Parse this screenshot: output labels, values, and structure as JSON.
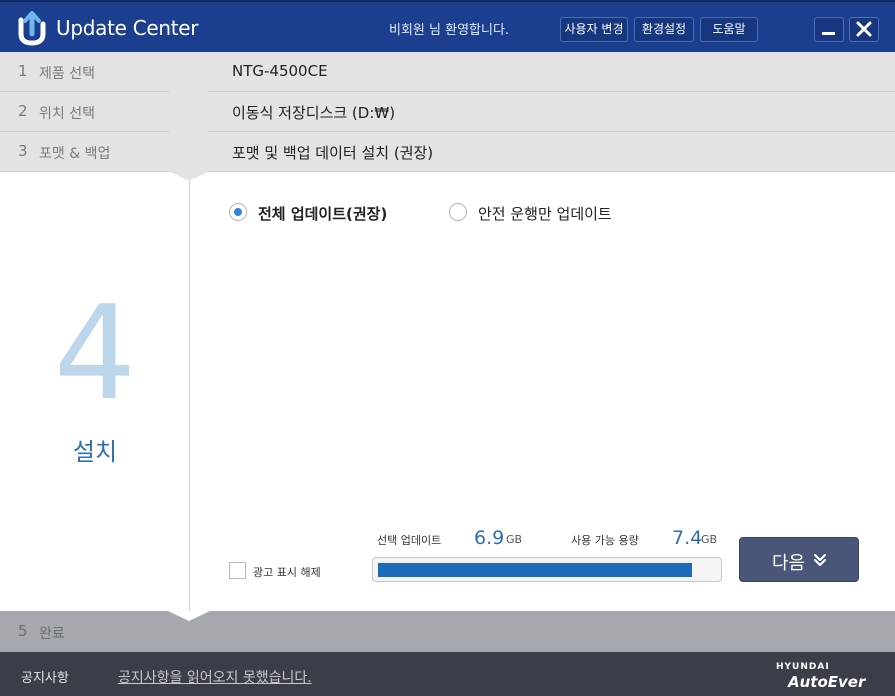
{
  "app": {
    "title": "Update Center",
    "welcome": "비회원 님 환영합니다.",
    "buttons": {
      "change_user": "사용자 변경",
      "settings": "환경설정",
      "help": "도움말"
    }
  },
  "steps": [
    {
      "num": "1",
      "name": "제품 선택",
      "value": "NTG-4500CE"
    },
    {
      "num": "2",
      "name": "위치 선택",
      "value": "이동식 저장디스크 (D:₩)"
    },
    {
      "num": "3",
      "name": "포맷 & 백업",
      "value": "포맷 및 백업 데이터 설치 (권장)"
    }
  ],
  "current_step": {
    "num": "4",
    "name": "설치"
  },
  "options": {
    "full_update": {
      "label": "전체 업데이트(권장)",
      "selected": true
    },
    "safe_only": {
      "label": "안전 운행만 업데이트",
      "selected": false
    }
  },
  "ad_toggle": {
    "label": "광고 표시 해제",
    "checked": false
  },
  "stats": {
    "selected_label": "선택 업데이트",
    "selected_value": "6.9",
    "selected_unit": "GB",
    "available_label": "사용 가능 용량",
    "available_value": "7.4",
    "available_unit": "GB",
    "progress_fraction": 0.93
  },
  "next_button": {
    "label": "다음",
    "chevron": "»"
  },
  "final_step": {
    "num": "5",
    "name": "완료"
  },
  "footer": {
    "notice_label": "공지사항",
    "notice_text": "공지사항을 읽어오지 못했습니다.",
    "brand_top": "HYUNDAI",
    "brand_bottom": "AutoEver"
  },
  "colors": {
    "titlebar": "#1b3f8e",
    "accent": "#2d6fb3",
    "progress": "#1a6cb8",
    "next_button": "#4a5678"
  },
  "icons": {
    "logo": "update-logo-icon",
    "minimize": "minimize-icon",
    "close": "close-icon",
    "next": "double-chevron-down-icon"
  }
}
